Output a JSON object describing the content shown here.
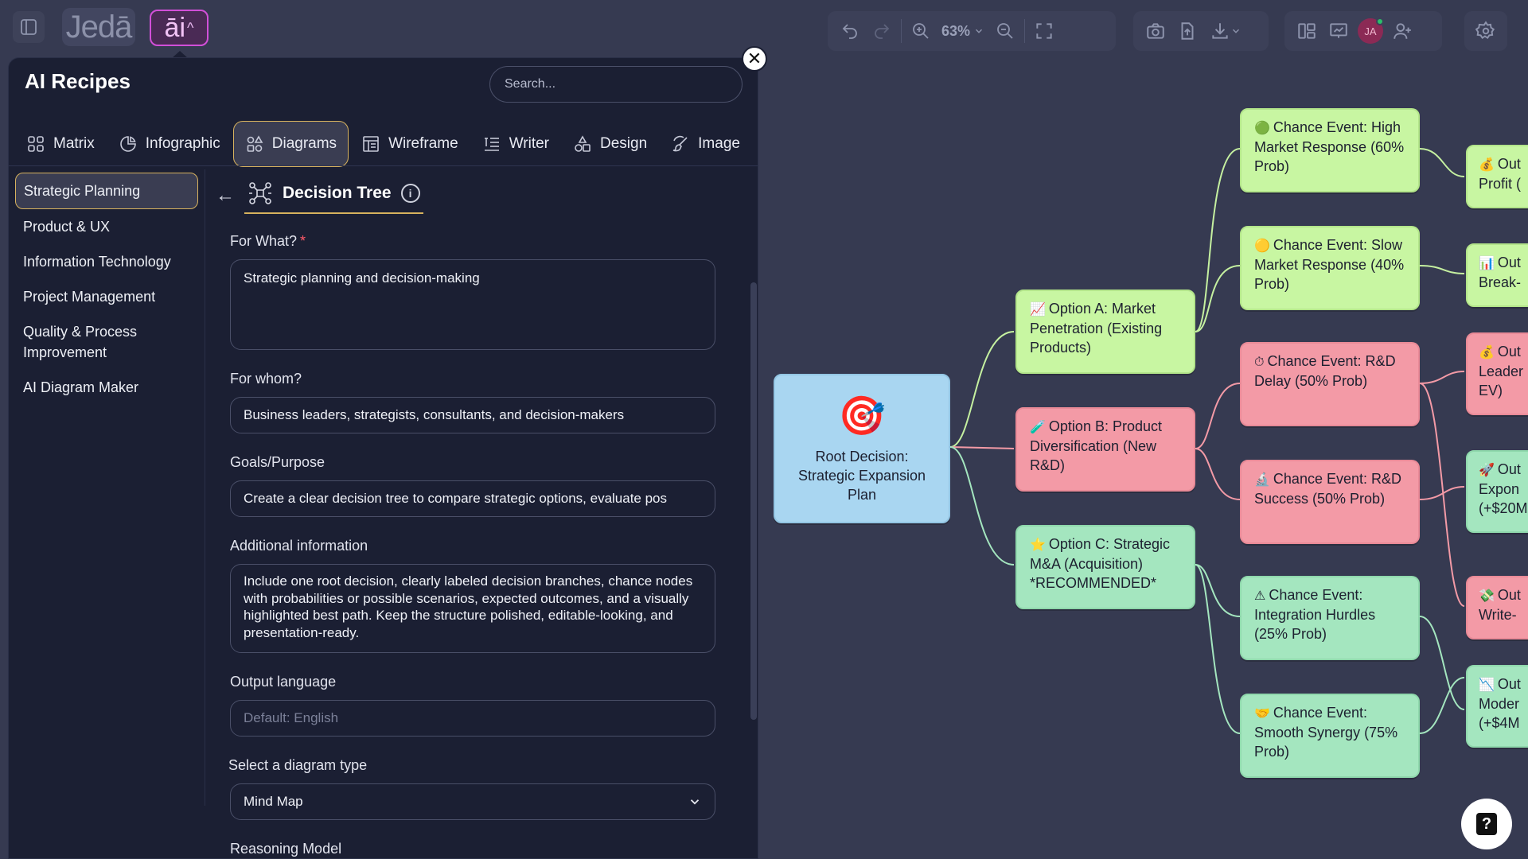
{
  "app": {
    "logo_text": "Jedā",
    "ai_label": "āi",
    "ai_chevron": "^"
  },
  "toolbar": {
    "zoom": "63%",
    "avatar_initials": "JA"
  },
  "panel": {
    "title": "AI Recipes",
    "search_placeholder": "Search...",
    "close": "✕",
    "tabs": [
      {
        "label": "Matrix"
      },
      {
        "label": "Infographic"
      },
      {
        "label": "Diagrams"
      },
      {
        "label": "Wireframe"
      },
      {
        "label": "Writer"
      },
      {
        "label": "Design"
      },
      {
        "label": "Image"
      }
    ],
    "categories": [
      {
        "label": "Strategic Planning"
      },
      {
        "label": "Product & UX"
      },
      {
        "label": "Information Technology"
      },
      {
        "label": "Project Management"
      },
      {
        "label": "Quality & Process Improvement"
      },
      {
        "label": "AI Diagram Maker"
      }
    ],
    "recipe": {
      "back": "←",
      "name": "Decision Tree",
      "info": "i"
    },
    "form": {
      "for_what_label": "For What?",
      "required_mark": "*",
      "for_what_value": "Strategic planning and decision-making",
      "for_whom_label": "For whom?",
      "for_whom_value": "Business leaders, strategists, consultants, and decision-makers",
      "goals_label": "Goals/Purpose",
      "goals_value": "Create a clear decision tree to compare strategic options, evaluate pos",
      "additional_label": "Additional information",
      "additional_value": "Include one root decision, clearly labeled decision branches, chance nodes with probabilities or possible scenarios, expected outcomes, and a visually highlighted best path. Keep the structure polished, editable-looking, and presentation-ready.",
      "output_language_label": "Output language",
      "output_language_placeholder": "Default: English",
      "diagram_type_label": "Select a diagram type",
      "diagram_type_value": "Mind Map",
      "reasoning_label": "Reasoning Model"
    }
  },
  "canvas": {
    "root": {
      "icon": "🎯",
      "text": "Root Decision: Strategic Expansion Plan"
    },
    "options": [
      {
        "icon": "📈",
        "text": "Option A: Market Penetration (Existing Products)"
      },
      {
        "icon": "🧪",
        "text": "Option B: Product Diversification (New R&D)"
      },
      {
        "icon": "⭐",
        "text": "Option C: Strategic M&A (Acquisition) *RECOMMENDED*"
      }
    ],
    "chances": [
      {
        "icon": "🟢",
        "text": "Chance Event: High Market Response (60% Prob)"
      },
      {
        "icon": "🟡",
        "text": "Chance Event: Slow Market Response (40% Prob)"
      },
      {
        "icon": "⏱",
        "text": "Chance Event: R&D Delay (50% Prob)"
      },
      {
        "icon": "🔬",
        "text": "Chance Event: R&D Success (50% Prob)"
      },
      {
        "icon": "⚠",
        "text": "Chance Event: Integration Hurdles (25% Prob)"
      },
      {
        "icon": "🤝",
        "text": "Chance Event: Smooth Synergy (75% Prob)"
      }
    ],
    "outcomes": [
      {
        "icon": "💰",
        "line1": "Out",
        "line2": "Profit (",
        "line3": ""
      },
      {
        "icon": "📊",
        "line1": "Out",
        "line2": "Break-",
        "line3": ""
      },
      {
        "icon": "💰",
        "line1": "Out",
        "line2": "Leader",
        "line3": "EV)"
      },
      {
        "icon": "🚀",
        "line1": "Out",
        "line2": "Expon",
        "line3": "(+$20M"
      },
      {
        "icon": "💸",
        "line1": "Out",
        "line2": "Write-",
        "line3": ""
      },
      {
        "icon": "📉",
        "line1": "Out",
        "line2": "Moder",
        "line3": "(+$4M"
      }
    ]
  },
  "help": {
    "label": "?"
  },
  "colors": {
    "accent_border": "#d7b25e",
    "ai_accent": "#d24fd8",
    "node_green": "#c8f6a2",
    "node_pink": "#f39aa6",
    "node_mint": "#a4e6bf",
    "node_blue": "#a9d6f1"
  }
}
